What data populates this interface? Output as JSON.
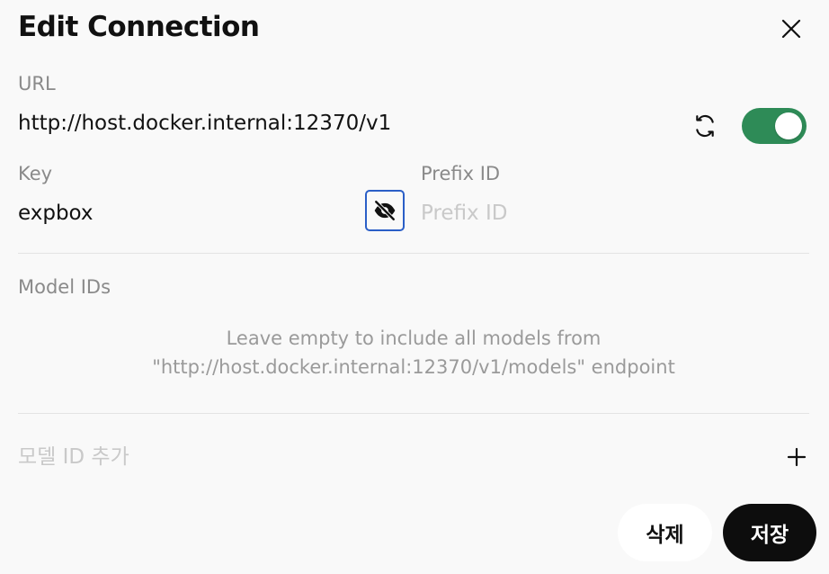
{
  "dialog": {
    "title": "Edit Connection"
  },
  "url": {
    "label": "URL",
    "value": "http://host.docker.internal:12370/v1",
    "enabled": true
  },
  "key": {
    "label": "Key",
    "value": "expbox"
  },
  "prefix": {
    "label": "Prefix ID",
    "placeholder": "Prefix ID"
  },
  "models": {
    "label": "Model IDs",
    "hint_line1": "Leave empty to include all models from",
    "hint_line2": "\"http://host.docker.internal:12370/v1/models\" endpoint",
    "add_placeholder": "모델 ID 추가"
  },
  "actions": {
    "delete_label": "삭제",
    "save_label": "저장"
  },
  "colors": {
    "toggle_on": "#2e8b57",
    "focus_ring": "#2b5fc7",
    "save_bg": "#0d0d0d"
  },
  "icons": [
    "close-icon",
    "refresh-icon",
    "eye-off-icon",
    "plus-icon"
  ]
}
